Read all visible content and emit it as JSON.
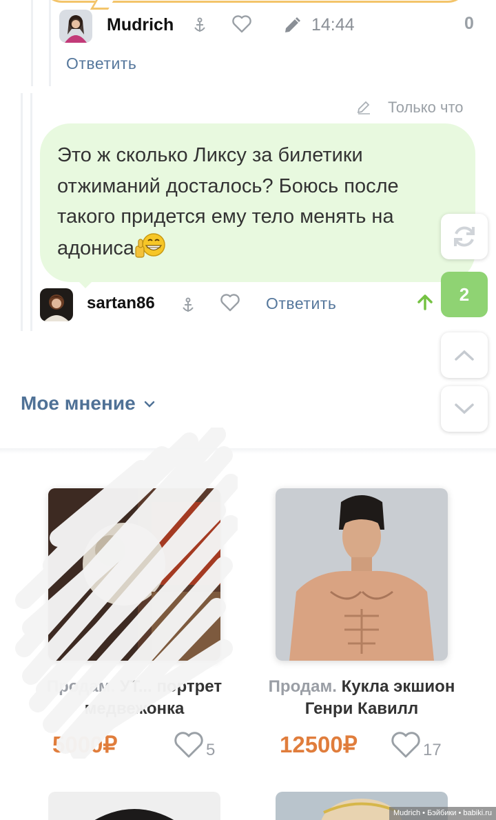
{
  "comment_top": {
    "author": "Mudrich",
    "time": "14:44",
    "score": "0",
    "reply_label": "Ответить"
  },
  "comment_main": {
    "timestamp": "Только что",
    "text": "Это ж сколько Ликсу за билетики отжиманий досталось? Боюсь после такого придется ему тело менять на адониса",
    "author": "sartan86",
    "reply_label": "Ответить",
    "score": "+2"
  },
  "side": {
    "new_count": "2"
  },
  "section": {
    "title": "Мое мнение"
  },
  "products": [
    {
      "prefix": "Продам.",
      "title": "УТ... портрет медвежонка",
      "price": "5000₽",
      "likes": "5"
    },
    {
      "prefix": "Продам.",
      "title": "Кукла экшион Генри Кавилл",
      "price": "12500₽",
      "likes": "17"
    }
  ],
  "watermark": "Mudrich • Бэйбики • babiki.ru",
  "colors": {
    "accent_blue": "#4f7196",
    "bubble_green": "#e8f9df",
    "score_green": "#8fd373",
    "price_orange": "#e07d3c"
  }
}
